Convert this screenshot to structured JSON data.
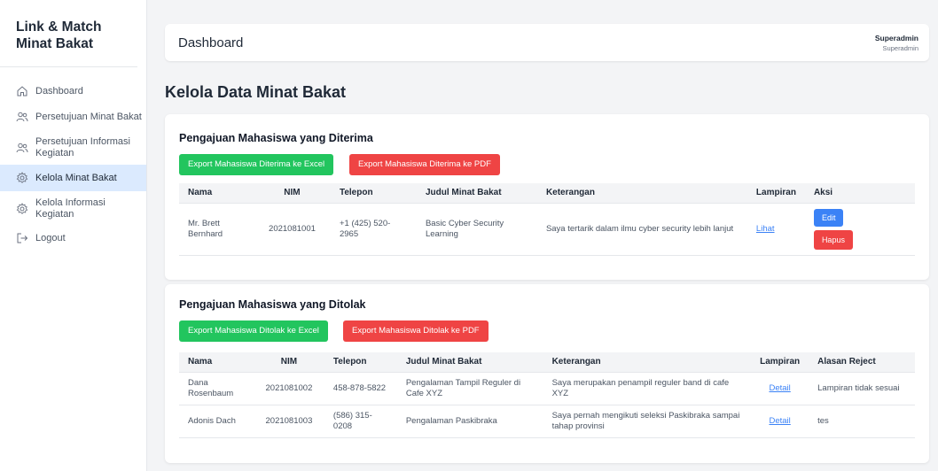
{
  "sidebar": {
    "brand_line1": "Link & Match",
    "brand_line2": "Minat Bakat",
    "items": [
      {
        "label": "Dashboard",
        "icon": "home-icon"
      },
      {
        "label": "Persetujuan Minat Bakat",
        "icon": "users-icon"
      },
      {
        "label": "Persetujuan Informasi Kegiatan",
        "icon": "users-icon"
      },
      {
        "label": "Kelola Minat Bakat",
        "icon": "gear-icon",
        "active": true
      },
      {
        "label": "Kelola Informasi Kegiatan",
        "icon": "gear-icon"
      },
      {
        "label": "Logout",
        "icon": "logout-icon"
      }
    ]
  },
  "header": {
    "title": "Dashboard",
    "user_name": "Superadmin",
    "user_role": "Superadmin"
  },
  "page": {
    "title": "Kelola Data Minat Bakat"
  },
  "accepted": {
    "title": "Pengajuan Mahasiswa yang Diterima",
    "export_excel": "Export Mahasiswa Diterima ke Excel",
    "export_pdf": "Export Mahasiswa Diterima ke PDF",
    "columns": [
      "Nama",
      "NIM",
      "Telepon",
      "Judul Minat Bakat",
      "Keterangan",
      "Lampiran",
      "Aksi"
    ],
    "rows": [
      {
        "nama": "Mr. Brett Bernhard",
        "nim": "2021081001",
        "telepon": "+1 (425) 520-2965",
        "judul": "Basic Cyber Security Learning",
        "keterangan": "Saya tertarik dalam ilmu cyber security lebih lanjut",
        "lampiran": "Lihat",
        "edit": "Edit",
        "hapus": "Hapus"
      }
    ]
  },
  "rejected": {
    "title": "Pengajuan Mahasiswa yang Ditolak",
    "export_excel": "Export Mahasiswa Ditolak ke Excel",
    "export_pdf": "Export Mahasiswa Ditolak ke PDF",
    "columns": [
      "Nama",
      "NIM",
      "Telepon",
      "Judul Minat Bakat",
      "Keterangan",
      "Lampiran",
      "Alasan Reject"
    ],
    "rows": [
      {
        "nama": "Dana Rosenbaum",
        "nim": "2021081002",
        "telepon": "458-878-5822",
        "judul": "Pengalaman Tampil Reguler di Cafe XYZ",
        "keterangan": "Saya merupakan penampil reguler band di cafe XYZ",
        "lampiran": "Detail",
        "alasan": "Lampiran tidak sesuai"
      },
      {
        "nama": "Adonis Dach",
        "nim": "2021081003",
        "telepon": "(586) 315-0208",
        "judul": "Pengalaman Paskibraka",
        "keterangan": "Saya pernah mengikuti seleksi Paskibraka sampai tahap provinsi",
        "lampiran": "Detail",
        "alasan": "tes"
      }
    ]
  },
  "colors": {
    "green": "#22c55e",
    "red": "#ef4444",
    "blue": "#3b82f6",
    "active_nav": "#dbeafe"
  }
}
